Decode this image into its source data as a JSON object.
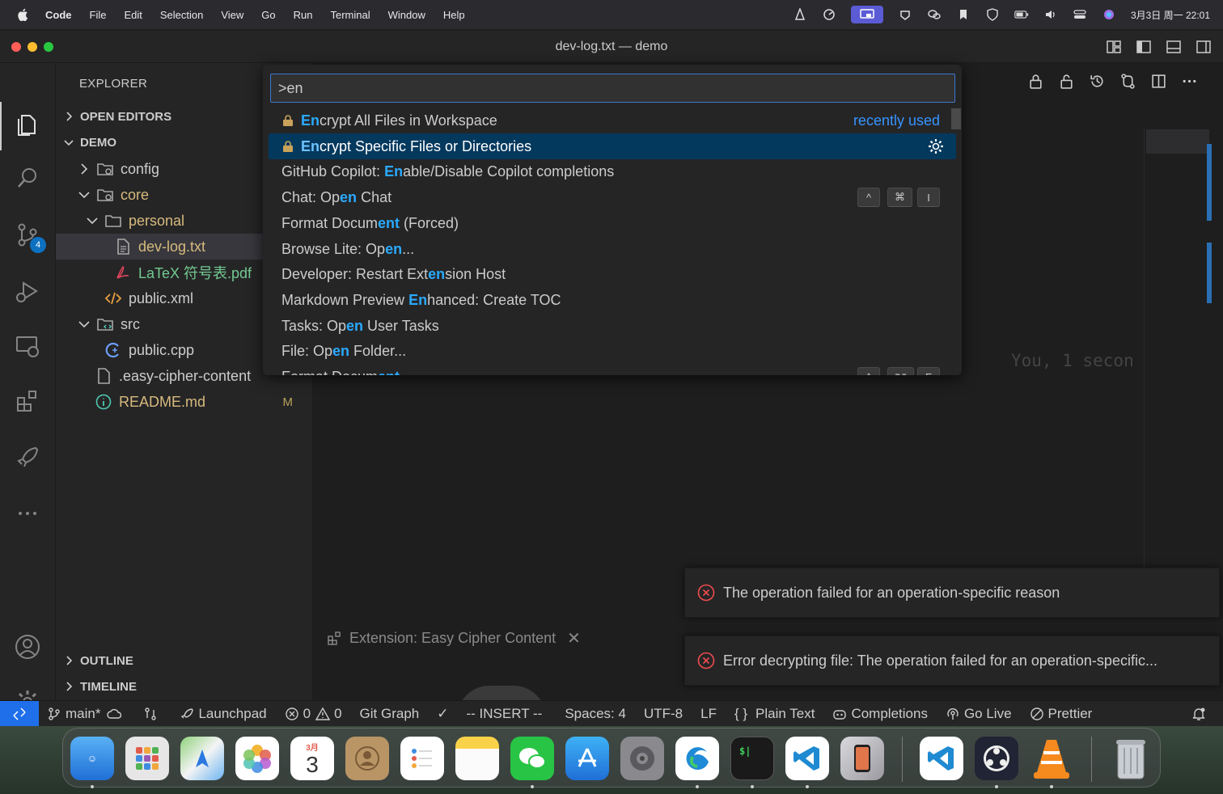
{
  "menubar": {
    "app": "Code",
    "items": [
      "File",
      "Edit",
      "Selection",
      "View",
      "Go",
      "Run",
      "Terminal",
      "Window",
      "Help"
    ],
    "clock": "3月3日 周一  22:01"
  },
  "window": {
    "title": "dev-log.txt — demo"
  },
  "activity_bar": {
    "scm_badge": "4"
  },
  "sidebar": {
    "header": "EXPLORER",
    "open_editors": "OPEN EDITORS",
    "project": "DEMO",
    "tree": [
      {
        "label": "config",
        "kind": "folder-config"
      },
      {
        "label": "core",
        "kind": "folder-config"
      },
      {
        "label": "personal",
        "kind": "folder"
      },
      {
        "label": "dev-log.txt",
        "kind": "file-text"
      },
      {
        "label": "LaTeX 符号表.pdf",
        "kind": "file-pdf"
      },
      {
        "label": "public.xml",
        "kind": "file-xml"
      },
      {
        "label": "src",
        "kind": "folder-src"
      },
      {
        "label": "public.cpp",
        "kind": "file-cpp"
      },
      {
        "label": ".easy-cipher-content",
        "kind": "file"
      },
      {
        "label": "README.md",
        "kind": "file-info",
        "git_status": "M"
      }
    ],
    "outline": "OUTLINE",
    "timeline": "TIMELINE"
  },
  "palette": {
    "query": ">en",
    "items": [
      {
        "pre": "",
        "hl": "En",
        "post": "crypt All Files in Workspace",
        "lock": true,
        "recent": "recently used"
      },
      {
        "pre": "",
        "hl": "En",
        "post": "crypt Specific Files or Directories",
        "lock": true,
        "selected": true
      },
      {
        "pre": "GitHub Copilot: ",
        "hl": "En",
        "post": "able/Disable Copilot completions"
      },
      {
        "pre": "Chat: Op",
        "hl": "en",
        "post": " Chat",
        "keys": [
          "^",
          "⌘",
          "I"
        ]
      },
      {
        "pre": "Format Docum",
        "hl": "ent",
        "post": " (Forced)"
      },
      {
        "pre": "Browse Lite: Op",
        "hl": "en",
        "post": "..."
      },
      {
        "pre": "Developer: Restart Ext",
        "hl": "en",
        "post": "sion Host"
      },
      {
        "pre": "Markdown Preview ",
        "hl": "En",
        "post": "hanced: Create TOC"
      },
      {
        "pre": "Tasks: Op",
        "hl": "en",
        "post": " User Tasks"
      },
      {
        "pre": "File: Op",
        "hl": "en",
        "post": " Folder..."
      },
      {
        "pre": "Format Docum",
        "hl": "ent",
        "post": "",
        "keys": [
          "^",
          "⌥",
          "F"
        ]
      }
    ]
  },
  "editor": {
    "blame": "You, 1 secon"
  },
  "notifications": [
    {
      "message": "The operation failed for an operation-specific reason"
    },
    {
      "message": "Error decrypting file: The operation failed for an operation-specific..."
    }
  ],
  "panel_tab": {
    "label": "Extension: Easy Cipher Content"
  },
  "statusbar": {
    "branch": "main*",
    "launchpad": "Launchpad",
    "errors": "0",
    "warnings": "0",
    "git_graph": "Git Graph",
    "vim_mode": "-- INSERT --",
    "spaces": "Spaces: 4",
    "encoding": "UTF-8",
    "eol": "LF",
    "language": "Plain Text",
    "completions": "Completions",
    "go_live": "Go Live",
    "prettier": "Prettier"
  },
  "dock": {
    "calendar_month": "3月",
    "calendar_day": "3",
    "apps": [
      "finder",
      "launchpad",
      "maps",
      "photos",
      "calendar",
      "contacts",
      "reminders",
      "notes",
      "wechat",
      "app-store",
      "system-settings",
      "edge",
      "terminal",
      "vscode",
      "iphone-mirroring",
      "vscode",
      "obs",
      "vlc",
      "trash"
    ]
  },
  "colors": {
    "accent": "#3a79d2",
    "highlight": "#2aaaff",
    "selected_bg": "#04395e",
    "error": "#f14c4c",
    "git_modified": "#b8a15a"
  }
}
